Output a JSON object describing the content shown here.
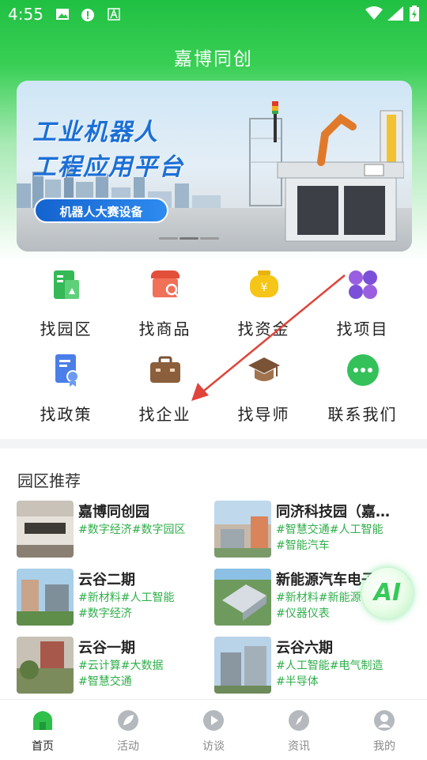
{
  "status_bar": {
    "time": "4:55"
  },
  "app": {
    "title": "嘉博同创"
  },
  "banner": {
    "line1": "工业机器人",
    "line2": "工程应用平台",
    "button": "机器人大赛设备"
  },
  "quick_links": [
    {
      "label": "找园区",
      "icon": "building-icon"
    },
    {
      "label": "找商品",
      "icon": "shop-icon"
    },
    {
      "label": "找资金",
      "icon": "money-bag-icon"
    },
    {
      "label": "找项目",
      "icon": "clover-icon"
    },
    {
      "label": "找政策",
      "icon": "policy-doc-icon"
    },
    {
      "label": "找企业",
      "icon": "briefcase-icon"
    },
    {
      "label": "找导师",
      "icon": "graduation-cap-icon"
    },
    {
      "label": "联系我们",
      "icon": "chat-bubble-icon"
    }
  ],
  "park_section": {
    "title": "园区推荐",
    "items": [
      {
        "name": "嘉博同创园",
        "tags1": "#数字经济#数字园区",
        "tags2": ""
      },
      {
        "name": "同济科技园（嘉…",
        "tags1": "#智慧交通#人工智能",
        "tags2": "#智能汽车"
      },
      {
        "name": "云谷二期",
        "tags1": "#新材料#人工智能",
        "tags2": "#数字经济"
      },
      {
        "name": "新能源汽车电子",
        "tags1": "#新材料#新能源",
        "tags2": "#仪器仪表"
      },
      {
        "name": "云谷一期",
        "tags1": "#云计算#大数据",
        "tags2": "#智慧交通"
      },
      {
        "name": "云谷六期",
        "tags1": "#人工智能#电气制造",
        "tags2": "#半导体"
      }
    ]
  },
  "ai_button": {
    "label": "AI"
  },
  "tabbar": [
    {
      "label": "首页",
      "icon": "home-icon",
      "active": true
    },
    {
      "label": "活动",
      "icon": "leaf-icon",
      "active": false
    },
    {
      "label": "访谈",
      "icon": "play-icon",
      "active": false
    },
    {
      "label": "资讯",
      "icon": "compass-icon",
      "active": false
    },
    {
      "label": "我的",
      "icon": "user-icon",
      "active": false
    }
  ],
  "colors": {
    "brand": "#2fbf4a",
    "tag": "#2fae4a",
    "arrow": "#e0443a"
  }
}
